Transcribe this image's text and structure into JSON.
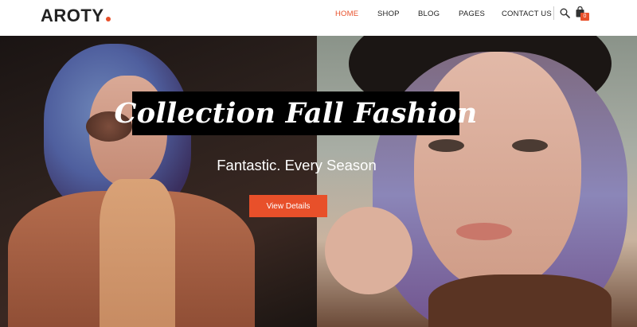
{
  "brand": {
    "name": "AROTY",
    "accent": "#e8502a"
  },
  "nav": {
    "items": [
      {
        "label": "HOME",
        "active": true
      },
      {
        "label": "SHOP",
        "active": false
      },
      {
        "label": "BLOG",
        "active": false
      },
      {
        "label": "PAGES",
        "active": false
      },
      {
        "label": "CONTACT US",
        "active": false
      }
    ],
    "icons": [
      "search-icon",
      "cart-icon"
    ],
    "cart_count": "0"
  },
  "hero": {
    "title": "Collection Fall Fashion",
    "subtitle": "Fantastic. Every Season",
    "cta_label": "View Details"
  }
}
